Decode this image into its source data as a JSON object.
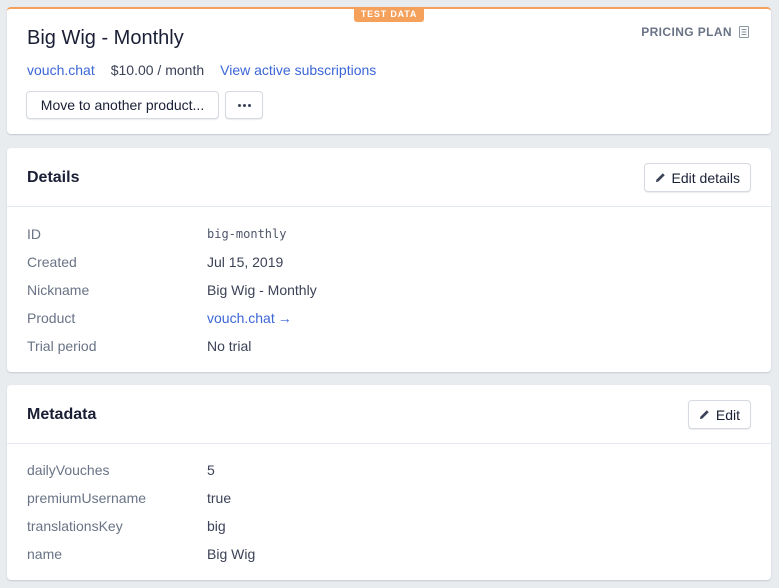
{
  "header": {
    "badge": "TEST DATA",
    "title": "Big Wig - Monthly",
    "type_label": "PRICING PLAN",
    "product_link": "vouch.chat",
    "price": "$10.00 / month",
    "subscriptions_link": "View active subscriptions",
    "move_button": "Move to another product...",
    "accent_color": "#f5a05b",
    "link_color": "#3b66d6"
  },
  "details": {
    "title": "Details",
    "edit_button": "Edit details",
    "rows": [
      {
        "key": "ID",
        "value": "big-monthly"
      },
      {
        "key": "Created",
        "value": "Jul 15, 2019"
      },
      {
        "key": "Nickname",
        "value": "Big Wig - Monthly"
      },
      {
        "key": "Product",
        "value": "vouch.chat"
      },
      {
        "key": "Trial period",
        "value": "No trial"
      }
    ]
  },
  "metadata": {
    "title": "Metadata",
    "edit_button": "Edit",
    "rows": [
      {
        "key": "dailyVouches",
        "value": "5"
      },
      {
        "key": "premiumUsername",
        "value": "true"
      },
      {
        "key": "translationsKey",
        "value": "big"
      },
      {
        "key": "name",
        "value": "Big Wig"
      }
    ]
  },
  "icons": {
    "plan": "document-icon",
    "edit": "pencil-icon",
    "more": "more-horizontal-icon",
    "product_arrow": "arrow-right-icon"
  }
}
